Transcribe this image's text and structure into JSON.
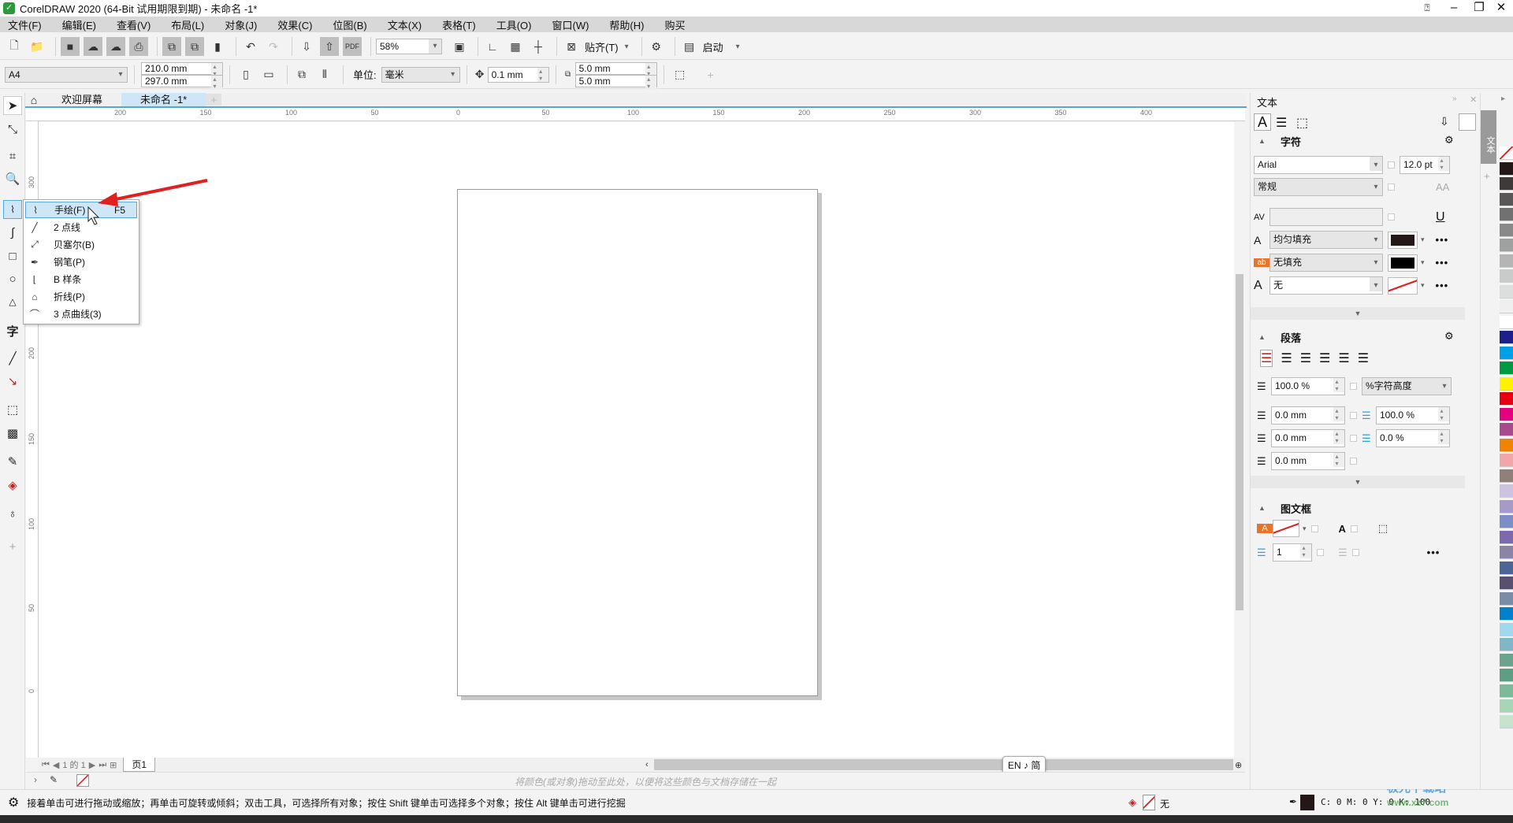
{
  "window": {
    "title": "CorelDRAW 2020 (64-Bit 试用期限到期) - 未命名 -1*",
    "controls": [
      "minimize",
      "restore",
      "close"
    ]
  },
  "menu": [
    "文件(F)",
    "编辑(E)",
    "查看(V)",
    "布局(L)",
    "对象(J)",
    "效果(C)",
    "位图(B)",
    "文本(X)",
    "表格(T)",
    "工具(O)",
    "窗口(W)",
    "帮助(H)",
    "购买"
  ],
  "toolbar": {
    "zoom": "58%",
    "snap": "贴齐(T)",
    "launch": "启动"
  },
  "propbar": {
    "page_size": "A4",
    "width": "210.0 mm",
    "height": "297.0 mm",
    "units_label": "单位:",
    "units": "毫米",
    "nudge": "0.1 mm",
    "dup_x": "5.0 mm",
    "dup_y": "5.0 mm"
  },
  "tabs": {
    "welcome": "欢迎屏幕",
    "document": "未命名 -1*"
  },
  "rulers": {
    "h": [
      "200",
      "150",
      "100",
      "50",
      "0",
      "50",
      "100",
      "150",
      "200",
      "250",
      "300",
      "350",
      "400"
    ],
    "v": [
      "300",
      "250",
      "200",
      "150",
      "100",
      "50",
      "0"
    ]
  },
  "flyout": [
    {
      "icon": "freehand-icon",
      "label": "手绘(F)",
      "shortcut": "F5",
      "selected": true
    },
    {
      "icon": "2-point-line-icon",
      "label": "2 点线"
    },
    {
      "icon": "bezier-icon",
      "label": "贝塞尔(B)"
    },
    {
      "icon": "pen-icon",
      "label": "钢笔(P)"
    },
    {
      "icon": "b-spline-icon",
      "label": "B 样条"
    },
    {
      "icon": "polyline-icon",
      "label": "折线(P)"
    },
    {
      "icon": "3-point-curve-icon",
      "label": "3 点曲线(3)"
    }
  ],
  "pagenav": {
    "position": "1 的 1",
    "page_tab": "页1"
  },
  "docpalette_hint": "将颜色(或对象)拖动至此处，以便将这些颜色与文档存储在一起",
  "ime": "EN ♪ 简",
  "status": {
    "hint": "接着单击可进行拖动或缩放；再单击可旋转或倾斜；双击工具，可选择所有对象；按住 Shift 键单击可选择多个对象；按住 Alt 键单击可进行挖掘",
    "fill": "无",
    "outline": "C: 0 M: 0 Y: 0 K: 100"
  },
  "docker": {
    "title": "文本",
    "tab_label": "文本",
    "character": {
      "title": "字符",
      "font": "Arial",
      "size": "12.0 pt",
      "style": "常规",
      "fill_type": "均匀填充",
      "fill_color": "#231815",
      "bg_fill": "无填充",
      "bg_color": "#000000",
      "outline": "无"
    },
    "paragraph": {
      "title": "段落",
      "line_spacing": "100.0 %",
      "spacing_unit": "%字符高度",
      "first_indent": "0.0 mm",
      "left_indent": "0.0 mm",
      "right_indent": "0.0 mm",
      "before": "100.0 %",
      "after": "0.0 %"
    },
    "frame": {
      "title": "图文框",
      "columns": "1"
    }
  },
  "palette": [
    "#ffffff",
    "#231815",
    "#3e3a39",
    "#595757",
    "#727171",
    "#898989",
    "#9fa0a0",
    "#b5b5b6",
    "#c9caca",
    "#dcdddd",
    "#efefef",
    "#ffffff",
    "#1d2088",
    "#00a0e9",
    "#009944",
    "#fff100",
    "#e60012",
    "#e4007f",
    "#a84a8b",
    "#f08300",
    "#f3a6a9",
    "#8f8178",
    "#cbc3e0",
    "#a69bc8",
    "#7b8ec8",
    "#7f69ad",
    "#8c83a8",
    "#4d6595",
    "#58506e",
    "#7a8ca8",
    "#0081cc",
    "#a0d8ef",
    "#7fb6c8",
    "#6ba38e",
    "#5e9e84",
    "#7bbb9a",
    "#a8d5b8",
    "#c5e3cf"
  ],
  "accent": "#58a6d6",
  "watermark": "极光下载站 www.xz7.com"
}
